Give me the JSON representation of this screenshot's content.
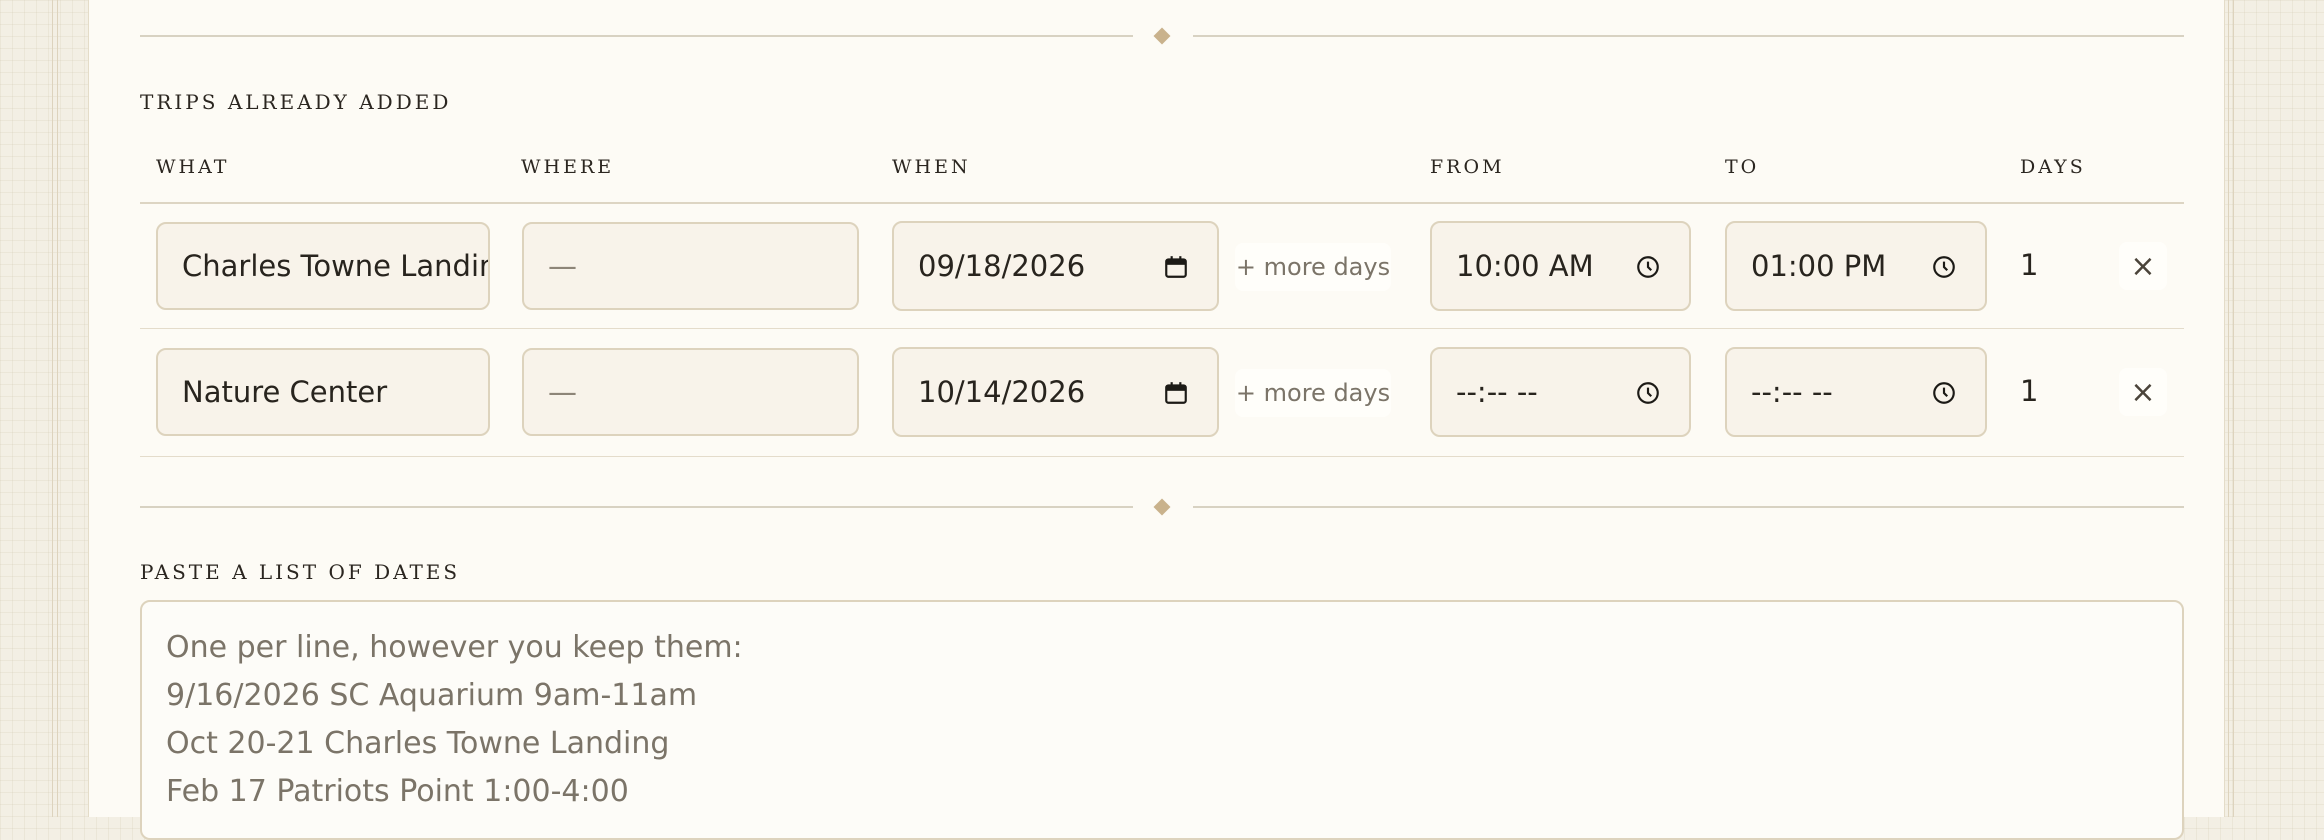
{
  "sections": {
    "trips_title": "TRIPS ALREADY ADDED",
    "paste_title": "PASTE A LIST OF DATES"
  },
  "columns": {
    "what": "WHAT",
    "where": "WHERE",
    "when": "WHEN",
    "from": "FROM",
    "to": "TO",
    "days": "DAYS"
  },
  "trips": [
    {
      "what": "Charles Towne Landing",
      "where": "—",
      "when": "09/18/2026",
      "more_days": "+ more days",
      "from": "10:00 AM",
      "to": "01:00 PM",
      "days": "1",
      "remove": "×"
    },
    {
      "what": "Nature Center",
      "where": "—",
      "when": "10/14/2026",
      "more_days": "+ more days",
      "from": "--:-- --",
      "to": "--:-- --",
      "days": "1",
      "remove": "×"
    }
  ],
  "paste": {
    "placeholder_lines": [
      "One per line, however you keep them:",
      "9/16/2026 SC Aquarium 9am-11am",
      "Oct 20-21 Charles Towne Landing",
      "Feb 17 Patriots Point 1:00-4:00"
    ]
  },
  "colors": {
    "card": "#fdfbf5",
    "field": "#f8f3ea",
    "border": "#ddd3bd",
    "accent_diamond": "#c9b28c"
  }
}
